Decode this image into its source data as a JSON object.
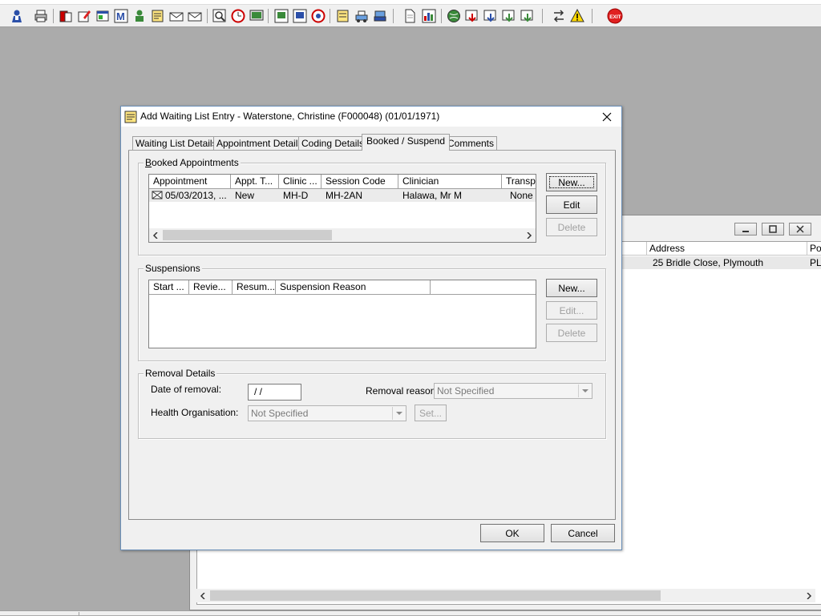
{
  "toolbar": {
    "icons": [
      "user-icon",
      "print-icon",
      "folder-icon",
      "edit-icon",
      "window-icon",
      "letter-m-icon",
      "person-icon",
      "notes-icon",
      "envelope-icon",
      "envelope-icon",
      "magnify-icon",
      "clock-icon",
      "monitor-icon",
      "report-icon",
      "chart-icon",
      "disc-icon",
      "list-icon",
      "transfer-icon",
      "phone-icon",
      "document-icon",
      "bar-chart-icon",
      "globe-icon",
      "arrow-down-icon",
      "arrow-down-icon",
      "arrow-down-icon",
      "swap-icon",
      "warning-icon",
      "exit-icon"
    ],
    "exit_label": "EXIT"
  },
  "background_window": {
    "columns": [
      "Address",
      "Po"
    ],
    "row": [
      "25 Bridle Close, Plymouth",
      "PL"
    ]
  },
  "dialog": {
    "title": "Add Waiting List Entry - Waterstone, Christine (F000048) (01/01/1971)",
    "tabs": [
      "Waiting List Details",
      "Appointment Details",
      "Coding Details",
      "Booked / Suspend",
      "Comments"
    ],
    "active_tab": "Booked / Suspend",
    "booked": {
      "label": "Booked Appointments",
      "columns": [
        "Appointment",
        "Appt. T...",
        "Clinic ...",
        "Session Code",
        "Clinician",
        "Transp"
      ],
      "rows": [
        [
          "05/03/2013, ...",
          "New",
          "MH-D",
          "MH-2AN",
          "Halawa, Mr M",
          "None"
        ]
      ],
      "buttons": {
        "new": "New...",
        "edit": "Edit",
        "delete": "Delete"
      }
    },
    "suspensions": {
      "label": "Suspensions",
      "columns": [
        "Start ...",
        "Revie...",
        "Resum...",
        "Suspension Reason",
        ""
      ],
      "buttons": {
        "new": "New...",
        "edit": "Edit...",
        "delete": "Delete"
      }
    },
    "removal": {
      "label": "Removal Details",
      "date_label": "Date of removal:",
      "date_value": " /  /",
      "reason_label": "Removal reason:",
      "reason_value": "Not Specified",
      "health_org_label": "Health Organisation:",
      "health_org_value": "Not Specified",
      "set_label": "Set..."
    },
    "ok": "OK",
    "cancel": "Cancel"
  },
  "colors": {
    "desktop": "#ababab",
    "selected_row": "#ebebeb",
    "exit": "#e02020"
  }
}
